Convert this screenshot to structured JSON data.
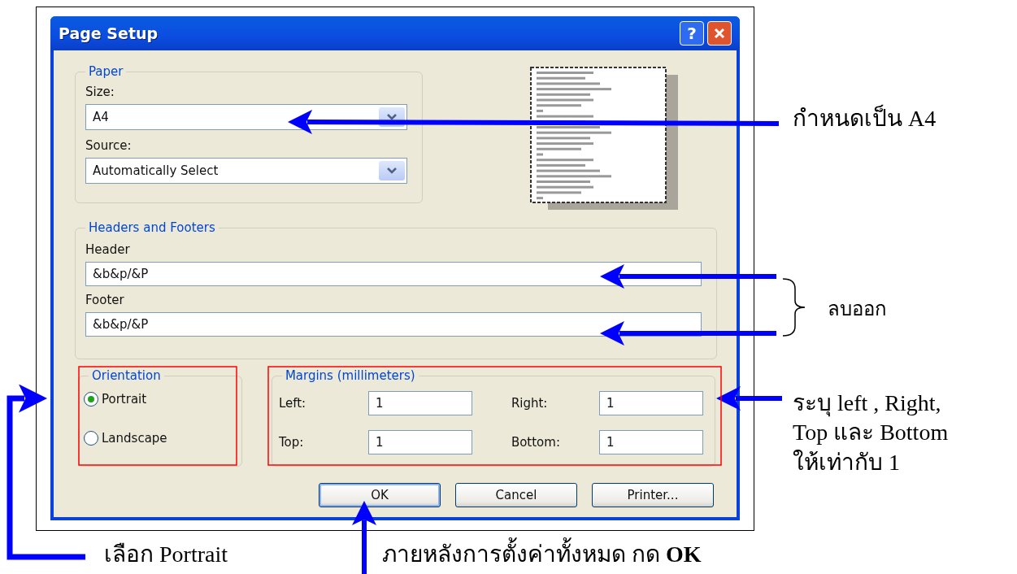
{
  "window": {
    "title": "Page Setup",
    "help": "?"
  },
  "paper": {
    "legend": "Paper",
    "size_label": "Size:",
    "size_value": "A4",
    "source_label": "Source:",
    "source_value": "Automatically Select"
  },
  "headers_footers": {
    "legend": "Headers and Footers",
    "header_label": "Header",
    "header_value": "&b&p/&P",
    "footer_label": "Footer",
    "footer_value": "&b&p/&P"
  },
  "orientation": {
    "legend": "Orientation",
    "options": [
      {
        "label": "Portrait",
        "selected": true
      },
      {
        "label": "Landscape",
        "selected": false
      }
    ]
  },
  "margins": {
    "legend": "Margins (millimeters)",
    "fields": [
      {
        "label": "Left:",
        "value": "1"
      },
      {
        "label": "Right:",
        "value": "1"
      },
      {
        "label": "Top:",
        "value": "1"
      },
      {
        "label": "Bottom:",
        "value": "1"
      }
    ]
  },
  "buttons": [
    {
      "label": "OK",
      "default": true
    },
    {
      "label": "Cancel",
      "default": false
    },
    {
      "label": "Printer...",
      "default": false
    }
  ],
  "annotations": [
    {
      "kind": "size",
      "text": "กำหนดเป็น A4"
    },
    {
      "kind": "headers",
      "text": "ลบออก"
    },
    {
      "kind": "margins",
      "text": "ระบุ left , Right, Top และ Bottom ให้เท่ากับ 1"
    },
    {
      "kind": "orientation",
      "text": "เลือก Portrait"
    },
    {
      "kind": "ok",
      "text": "ภายหลังการตั้งค่าทั้งหมด กด **OK**"
    }
  ]
}
